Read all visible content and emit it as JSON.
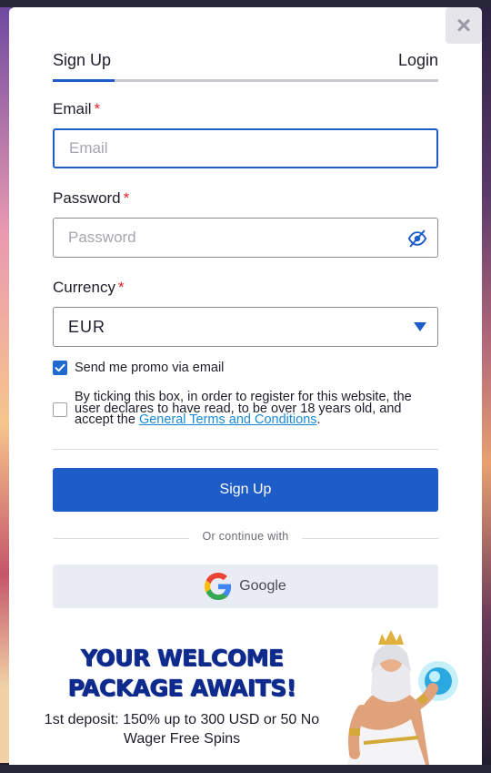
{
  "tabs": {
    "signup": "Sign Up",
    "login": "Login"
  },
  "close_label": "×",
  "email": {
    "label": "Email",
    "required": "*",
    "placeholder": "Email",
    "value": ""
  },
  "password": {
    "label": "Password",
    "required": "*",
    "placeholder": "Password",
    "value": ""
  },
  "currency": {
    "label": "Currency",
    "required": "*",
    "selected": "EUR"
  },
  "promo_checkbox": {
    "label": "Send me promo via email",
    "checked": true
  },
  "terms_checkbox": {
    "checked": false,
    "text_before": "By ticking this box, in order to register for this website, the user declares to have read, to be over 18 years old, and accept the ",
    "link_text": "General Terms and Conditions",
    "text_after": "."
  },
  "signup_button": "Sign Up",
  "or_continue": "Or continue with",
  "google_button": "Google",
  "promo": {
    "title_line1": "YOUR WELCOME",
    "title_line2": "PACKAGE AWAITS!",
    "description": "1st deposit: 150% up to 300 USD or 50 No Wager Free Spins"
  },
  "colors": {
    "accent": "#1e5cc8",
    "required": "#e0242b",
    "link": "#1a8ad8",
    "promo_title": "#0e2a8c"
  },
  "icons": [
    "close-icon",
    "eye-slash-icon",
    "chevron-down-icon",
    "check-icon",
    "google-logo-icon",
    "zeus-illustration"
  ]
}
